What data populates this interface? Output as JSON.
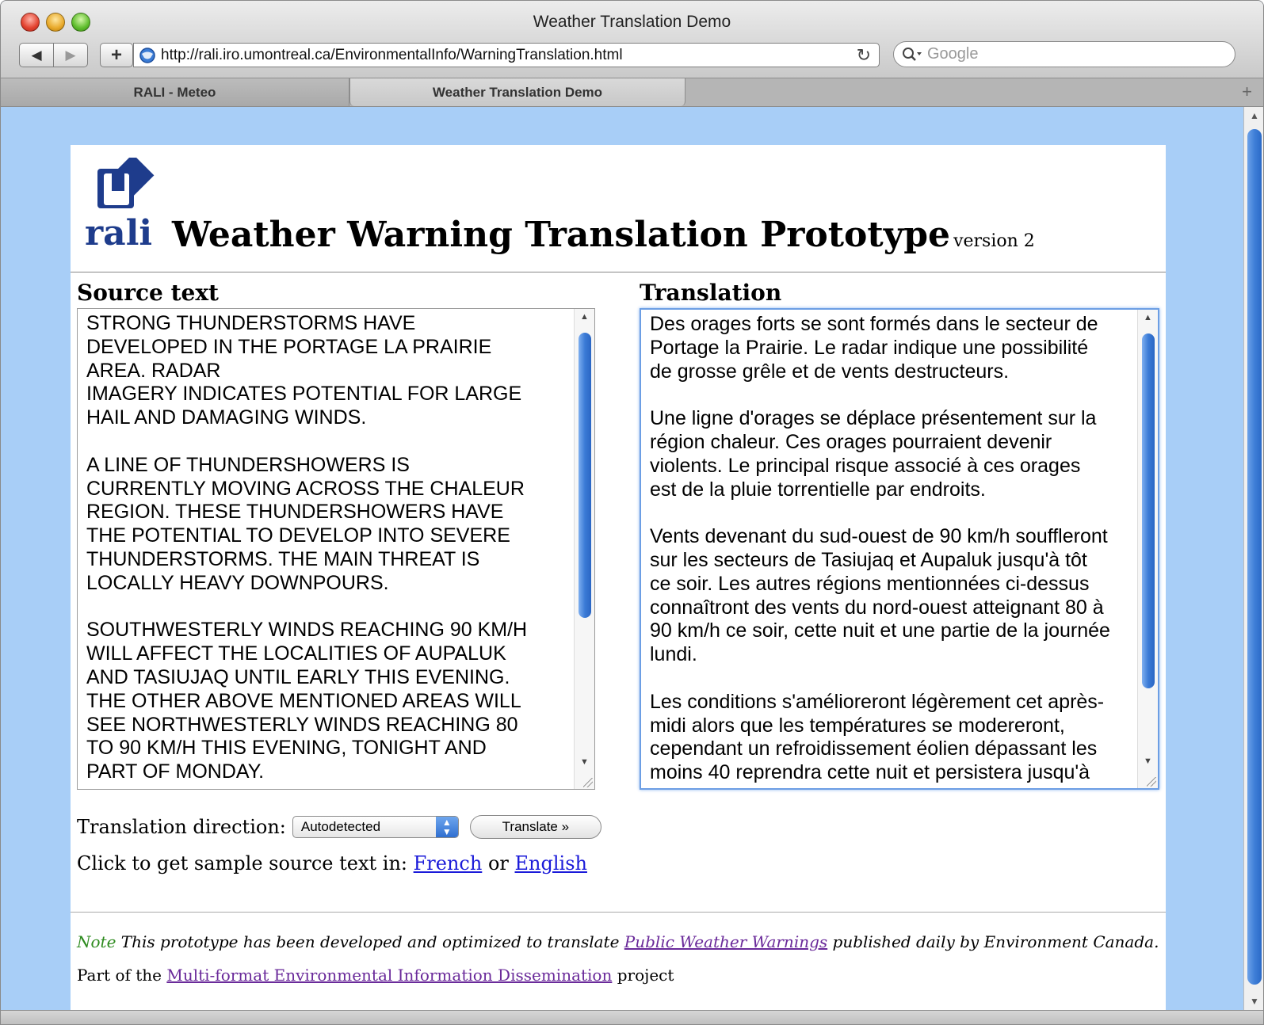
{
  "window": {
    "title": "Weather Translation Demo"
  },
  "toolbar": {
    "back_icon": "back-arrow-icon",
    "back_glyph": "◀",
    "forward_glyph": "▶",
    "add_glyph": "+",
    "url": "http://rali.iro.umontreal.ca/EnvironmentalInfo/WarningTranslation.html",
    "reload_glyph": "↻",
    "search_placeholder": "Google"
  },
  "tabs": [
    {
      "label": "RALI - Meteo",
      "active": false
    },
    {
      "label": "Weather Translation Demo",
      "active": true
    }
  ],
  "page": {
    "logo_text": "rali",
    "title": "Weather Warning Translation Prototype",
    "version": "version 2",
    "source_label": "Source text",
    "translation_label": "Translation",
    "source_text": "STRONG THUNDERSTORMS HAVE\nDEVELOPED IN THE PORTAGE LA PRAIRIE\nAREA. RADAR\nIMAGERY INDICATES POTENTIAL FOR LARGE\nHAIL AND DAMAGING WINDS.\n\nA LINE OF THUNDERSHOWERS IS\nCURRENTLY MOVING ACROSS THE CHALEUR\nREGION. THESE THUNDERSHOWERS HAVE\nTHE POTENTIAL TO DEVELOP INTO SEVERE\nTHUNDERSTORMS. THE MAIN THREAT IS\nLOCALLY HEAVY DOWNPOURS.\n\nSOUTHWESTERLY WINDS REACHING 90 KM/H\nWILL AFFECT THE LOCALITIES OF AUPALUK\nAND TASIUJAQ UNTIL EARLY THIS EVENING.\nTHE OTHER ABOVE MENTIONED AREAS WILL\nSEE NORTHWESTERLY WINDS REACHING 80\nTO 90 KM/H THIS EVENING, TONIGHT AND\nPART OF MONDAY.",
    "translation_text": "Des orages forts se sont formés dans le secteur de\nPortage la Prairie. Le radar indique une possibilité\nde grosse grêle et de vents destructeurs.\n\nUne ligne d'orages se déplace présentement sur la\nrégion chaleur. Ces orages pourraient devenir\nviolents. Le principal risque associé à ces orages\nest de la pluie torrentielle par endroits.\n\nVents devenant du sud-ouest de 90 km/h souffleront\nsur les secteurs de Tasiujaq et Aupaluk jusqu'à tôt\nce soir. Les autres régions mentionnées ci-dessus\nconnaîtront des vents du nord-ouest atteignant 80 à\n90 km/h ce soir, cette nuit et une partie de la journée\nlundi.\n\nLes conditions s'amélioreront légèrement cet après-\nmidi alors que les températures se modereront,\ncependant un refroidissement éolien dépassant les\nmoins 40 reprendra cette nuit et persistera jusqu'à",
    "direction_label": "Translation direction:",
    "direction_value": "Autodetected",
    "translate_button": "Translate »",
    "sample_prefix": "Click to get sample source text in: ",
    "sample_french": "French",
    "sample_or": " or ",
    "sample_english": "English",
    "note_label": "Note",
    "note_text_before": " This prototype has been developed and optimized to translate ",
    "note_link": "Public Weather Warnings",
    "note_text_after": " published daily by Environment Canada.",
    "project_before": "Part of the ",
    "project_link": "Multi-format Environmental Information Dissemination",
    "project_after": " project"
  },
  "colors": {
    "page_background": "#a8cef7",
    "logo_blue": "#1e3c8c",
    "link": "#1a1ad9",
    "visited_link": "#6a2a9a",
    "note_green": "#2e8b1f"
  }
}
